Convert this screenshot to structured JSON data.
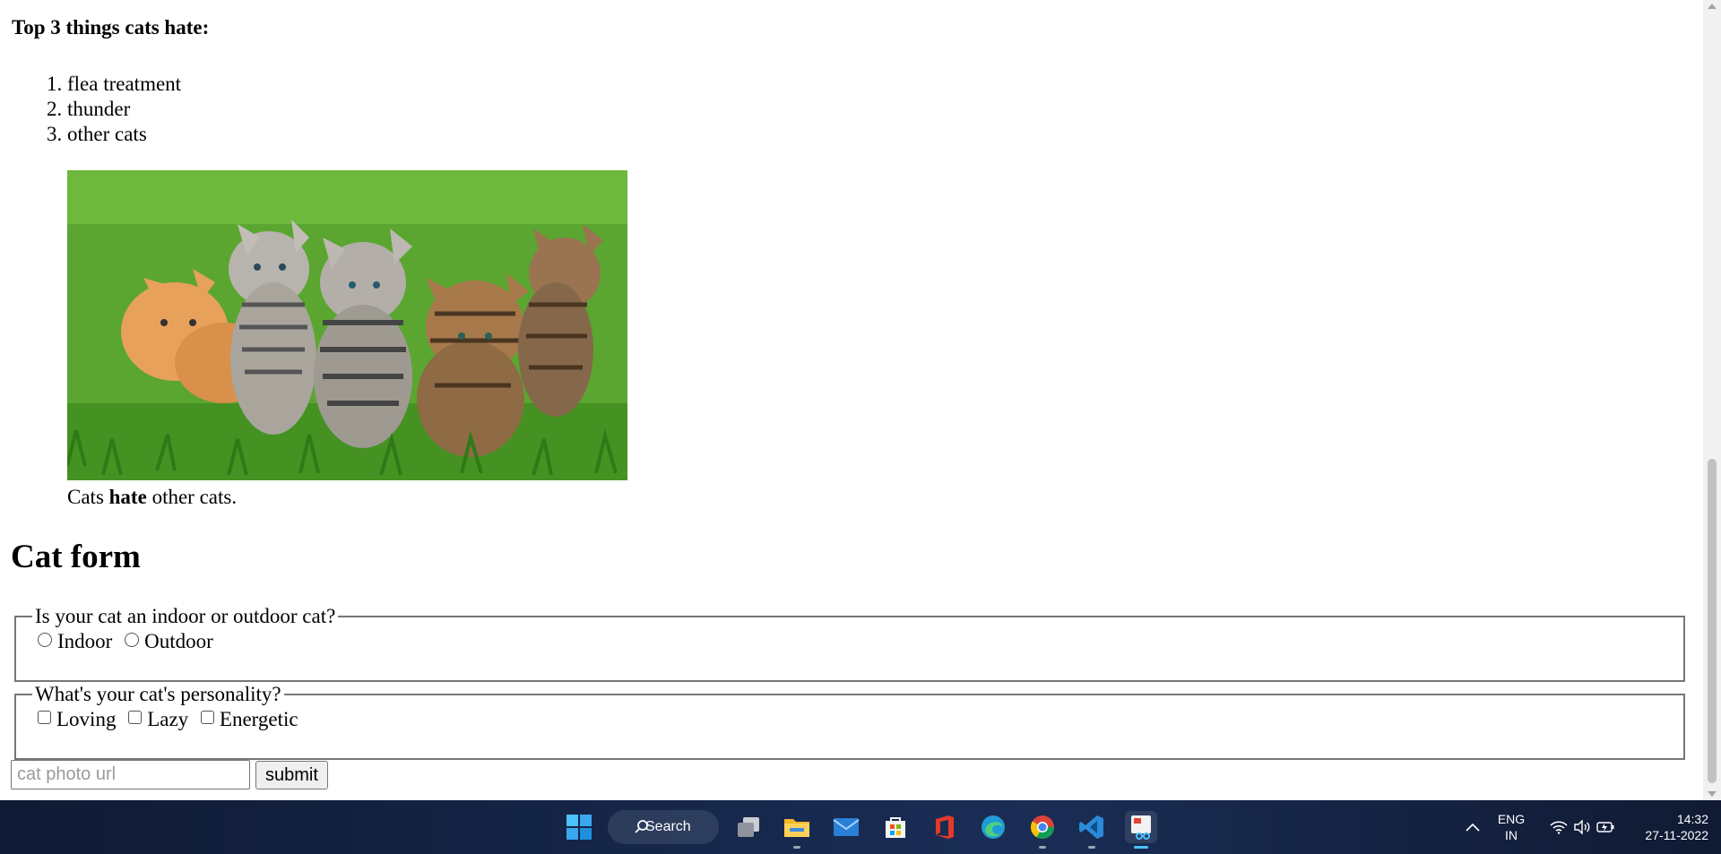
{
  "content": {
    "list_heading": "Top 3 things cats hate:",
    "hates": [
      {
        "num": "1",
        "text": "flea treatment"
      },
      {
        "num": "2",
        "text": "thunder"
      },
      {
        "num": "3",
        "text": "other cats"
      }
    ],
    "caption": {
      "pre": "Cats ",
      "bold": "hate",
      "post": " other cats."
    }
  },
  "form": {
    "title": "Cat form",
    "indoor_outdoor": {
      "legend": "Is your cat an indoor or outdoor cat?",
      "options": [
        "Indoor",
        "Outdoor"
      ]
    },
    "personality": {
      "legend": "What's your cat's personality?",
      "options": [
        "Loving",
        "Lazy",
        "Energetic"
      ]
    },
    "url_placeholder": "cat photo url",
    "submit_label": "submit"
  },
  "taskbar": {
    "search_label": "Search",
    "language": "ENG",
    "region": "IN",
    "time": "14:32",
    "date": "27-11-2022"
  }
}
